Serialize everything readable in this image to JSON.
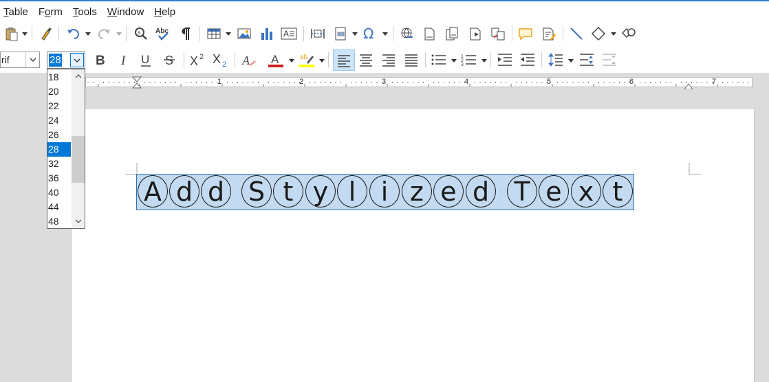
{
  "menu": [
    {
      "label": "Table",
      "underline": "T"
    },
    {
      "label": "Form",
      "underline": "o"
    },
    {
      "label": "Tools",
      "underline": "T"
    },
    {
      "label": "Window",
      "underline": "W"
    },
    {
      "label": "Help",
      "underline": "H"
    }
  ],
  "formatting": {
    "font_name": "rif",
    "font_size": "28"
  },
  "font_size_dropdown": {
    "options": [
      "18",
      "20",
      "22",
      "24",
      "26",
      "28",
      "32",
      "36",
      "40",
      "44",
      "48"
    ],
    "selected": "28"
  },
  "ruler": {
    "labels": [
      "1",
      "2",
      "3",
      "4",
      "5",
      "6",
      "7"
    ]
  },
  "document": {
    "text": "Add Stylized Text",
    "letters": [
      "A",
      "d",
      "d",
      "S",
      "t",
      "y",
      "l",
      "i",
      "z",
      "e",
      "d",
      "T",
      "e",
      "x",
      "t"
    ]
  },
  "colors": {
    "accent": "#0078d7",
    "font_color_bar": "#c9211e",
    "highlight_bar": "#ffff00",
    "selection": "#c3daf0",
    "icon_blue": "#3b74c2"
  },
  "icons": {
    "toolbar1": [
      "paste-icon",
      "clone-formatting-icon",
      "undo-icon",
      "redo-icon",
      "find-replace-icon",
      "spelling-icon",
      "formatting-marks-icon",
      "insert-table-icon",
      "insert-image-icon",
      "insert-chart-icon",
      "insert-textbox-icon",
      "insert-page-break-icon",
      "insert-field-icon",
      "special-character-icon",
      "insert-hyperlink-icon",
      "insert-footnote-icon",
      "insert-endnote-icon",
      "insert-bookmark-icon",
      "insert-cross-reference-icon",
      "insert-comment-icon",
      "track-changes-icon",
      "insert-line-icon",
      "basic-shapes-icon",
      "draw-functions-icon"
    ],
    "toolbar2": [
      "bold-icon",
      "italic-icon",
      "underline-icon",
      "strikethrough-icon",
      "superscript-icon",
      "subscript-icon",
      "clear-formatting-icon",
      "font-color-icon",
      "highlight-color-icon",
      "align-left-icon",
      "align-center-icon",
      "align-right-icon",
      "justify-icon",
      "bullet-list-icon",
      "numbered-list-icon",
      "increase-indent-icon",
      "decrease-indent-icon",
      "line-spacing-icon",
      "paragraph-spacing-increase-icon",
      "paragraph-spacing-decrease-icon"
    ]
  }
}
